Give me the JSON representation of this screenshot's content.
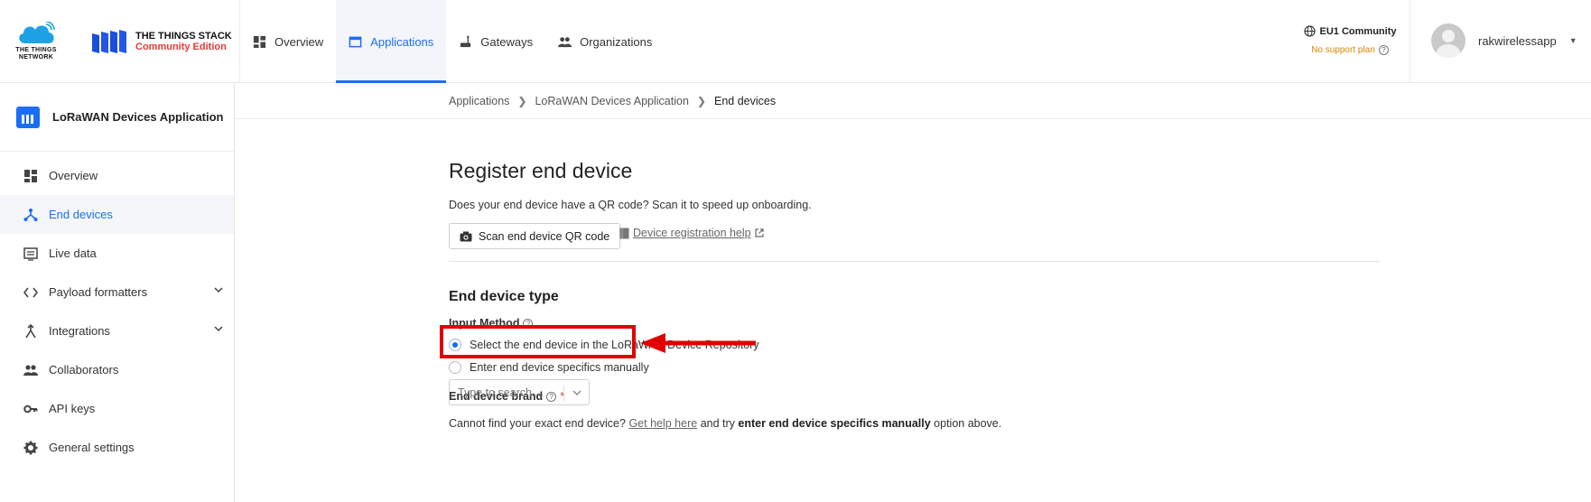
{
  "brand": {
    "ttn_logo_text": "THE THINGS NETWORK",
    "tts_line1": "THE THINGS STACK",
    "tts_line2": "Community Edition",
    "accent": "#1b6ef3",
    "edition_color": "#e53935"
  },
  "topnav": {
    "items": [
      {
        "label": "Overview",
        "icon": "grid-icon",
        "active": false
      },
      {
        "label": "Applications",
        "icon": "window-icon",
        "active": true
      },
      {
        "label": "Gateways",
        "icon": "gateway-icon",
        "active": false
      },
      {
        "label": "Organizations",
        "icon": "people-icon",
        "active": false
      }
    ]
  },
  "cluster": {
    "name": "EU1 Community",
    "plan": "No support plan"
  },
  "user": {
    "name": "rakwirelessapp"
  },
  "sidebar": {
    "app_title": "LoRaWAN Devices Application",
    "items": [
      {
        "label": "Overview",
        "icon": "grid-icon",
        "active": false
      },
      {
        "label": "End devices",
        "icon": "device-tree-icon",
        "active": true
      },
      {
        "label": "Live data",
        "icon": "list-icon",
        "active": false
      },
      {
        "label": "Payload formatters",
        "icon": "code-icon",
        "active": false,
        "expandable": true
      },
      {
        "label": "Integrations",
        "icon": "integration-icon",
        "active": false,
        "expandable": true
      },
      {
        "label": "Collaborators",
        "icon": "people-icon",
        "active": false
      },
      {
        "label": "API keys",
        "icon": "key-icon",
        "active": false
      },
      {
        "label": "General settings",
        "icon": "gear-icon",
        "active": false
      }
    ]
  },
  "breadcrumb": {
    "items": [
      "Applications",
      "LoRaWAN Devices Application",
      "End devices"
    ]
  },
  "main": {
    "title": "Register end device",
    "qr_hint": "Does your end device have a QR code? Scan it to speed up onboarding.",
    "scan_button": "Scan end device QR code",
    "help_link": "Device registration help",
    "section_title": "End device type",
    "input_method_label": "Input Method",
    "radio_options": [
      {
        "label": "Select the end device in the LoRaWAN Device Repository",
        "selected": true
      },
      {
        "label": "Enter end device specifics manually",
        "selected": false
      }
    ],
    "brand_label": "End device brand",
    "brand_required": "*",
    "brand_placeholder": "Type to search...",
    "note_prefix": "Cannot find your exact end device?",
    "note_link": "Get help here",
    "note_mid": "and try",
    "note_strong": "enter end device specifics manually",
    "note_suffix": "option above."
  },
  "annotation": {
    "color": "#e00000"
  }
}
